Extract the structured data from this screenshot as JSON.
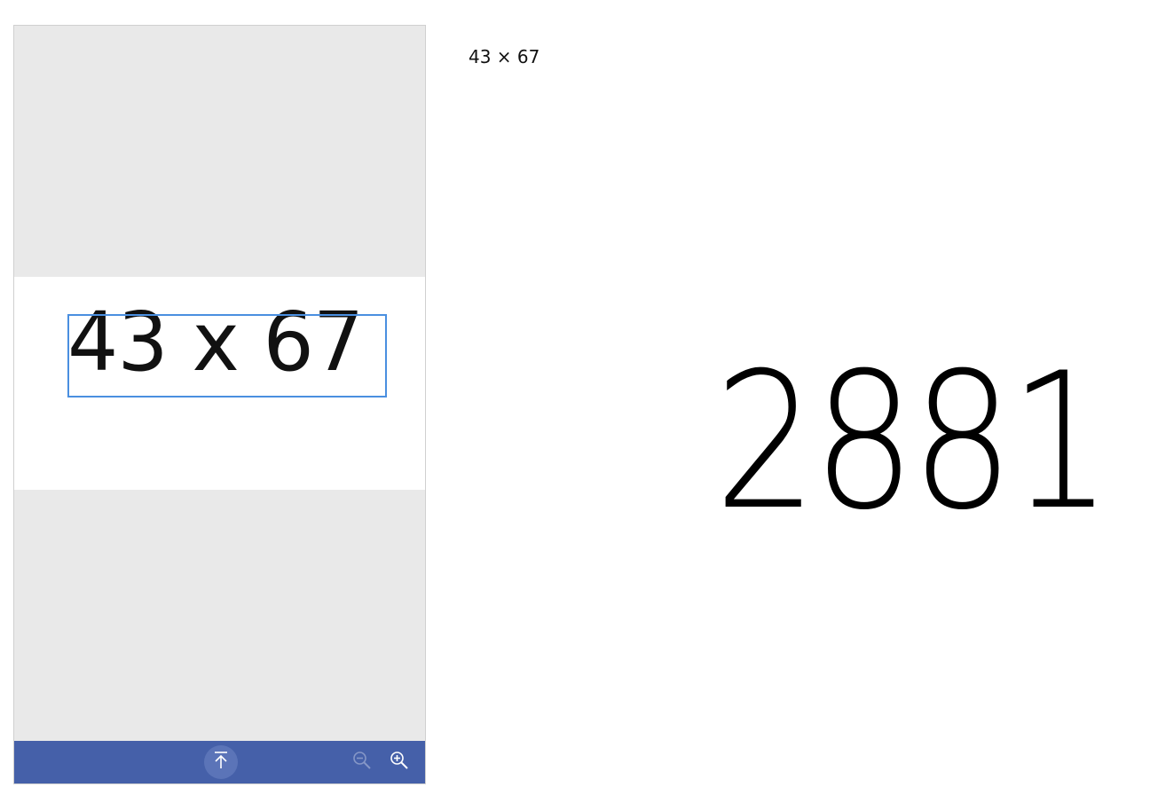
{
  "viewer": {
    "captured_text": "43 x 67",
    "toolbar": {
      "capture_icon": "upload-arrow-icon",
      "zoom_out_icon": "zoom-out-icon",
      "zoom_in_icon": "zoom-in-icon"
    }
  },
  "result_panel": {
    "expression": "43 × 67",
    "result": "2881"
  },
  "colors": {
    "toolbar": "#4560a9",
    "selection": "#4a8fe0",
    "viewer_background": "#e9e9e9"
  }
}
